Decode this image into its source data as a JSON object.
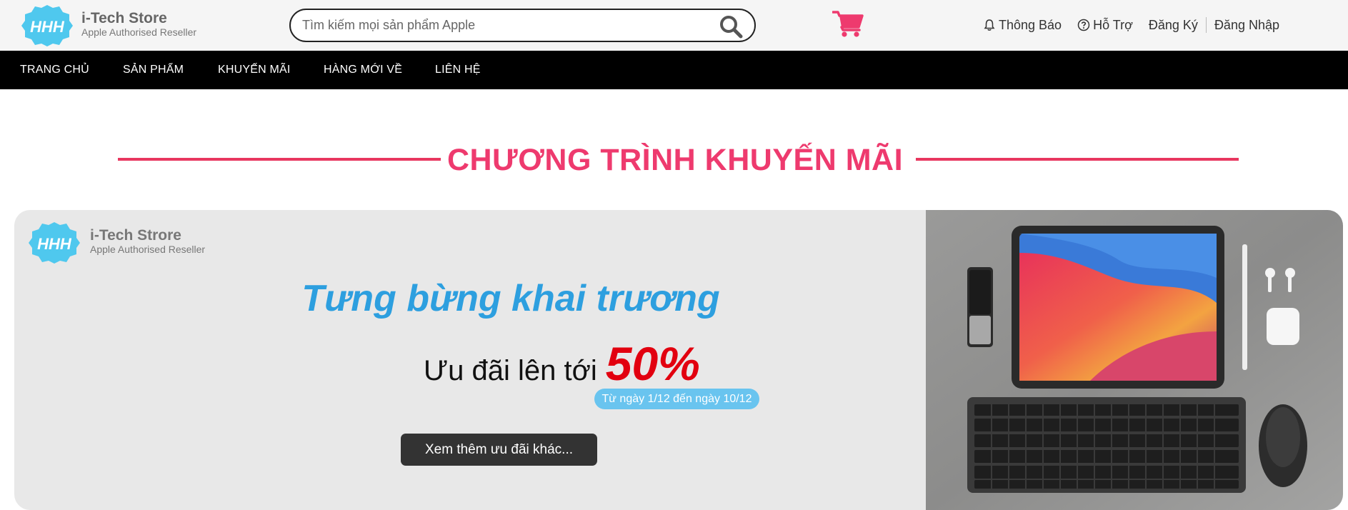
{
  "brand": {
    "name": "i-Tech Store",
    "tagline": "Apple Authorised Reseller",
    "badge_text": "HHH",
    "badge_color": "#4fc8ee"
  },
  "search": {
    "placeholder": "Tìm kiếm mọi sản phẩm Apple",
    "icon": "search-icon"
  },
  "cart": {
    "icon": "cart-icon",
    "color": "#ee3a6e"
  },
  "top_links": {
    "notifications": "Thông Báo",
    "support": "Hỗ Trợ",
    "register": "Đăng Ký",
    "login": "Đăng Nhập"
  },
  "nav": {
    "items": [
      "TRANG CHỦ",
      "SẢN PHẨM",
      "KHUYẾN MÃI",
      "HÀNG MỚI VỀ",
      "LIÊN HỆ"
    ]
  },
  "section": {
    "title": "CHƯƠNG TRÌNH KHUYẾN MÃI",
    "accent_color": "#e8375f"
  },
  "banner": {
    "brand_name": "i-Tech Strore",
    "brand_tagline": "Apple Authorised Reseller",
    "headline": "Tưng bừng khai trương",
    "offer_text": "Ưu đãi lên tới",
    "offer_percent": "50%",
    "date_range": "Từ ngày 1/12 đến ngày 10/12",
    "cta_label": "Xem thêm ưu đãi khác...",
    "headline_color": "#2d9fdf",
    "percent_color": "#e2000f"
  }
}
